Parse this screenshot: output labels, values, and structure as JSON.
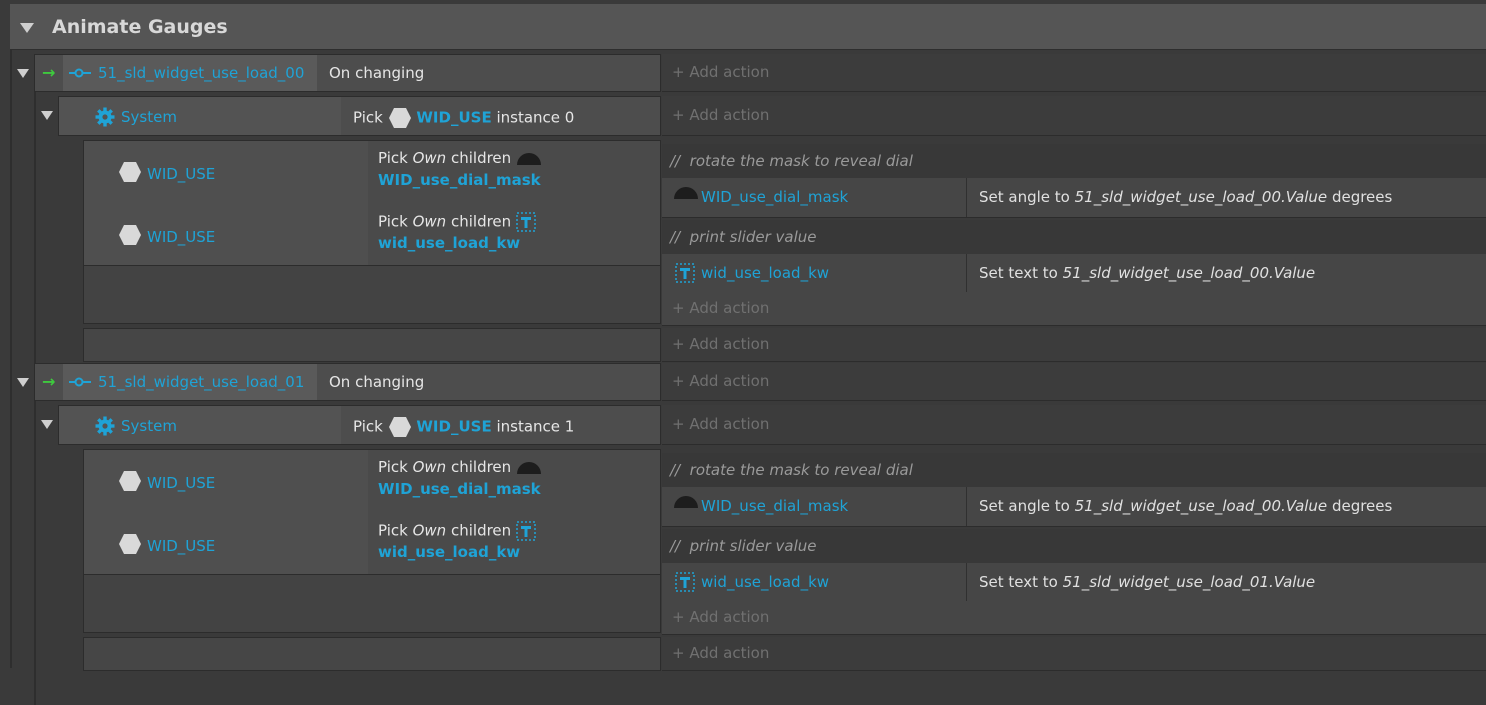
{
  "group": {
    "title": "Animate Gauges"
  },
  "add_action_label": "Add action",
  "blocks": [
    {
      "trigger_object": "51_sld_widget_use_load_00",
      "trigger_condition": "On changing",
      "system_label": "System",
      "pick_word": "Pick",
      "pick_object": "WID_USE",
      "pick_instance": "instance 0",
      "sub1_object": "WID_USE",
      "sub1_pick": "Pick",
      "sub1_own": "Own",
      "sub1_children": "children",
      "sub1_target": "WID_use_dial_mask",
      "sub2_object": "WID_USE",
      "sub2_pick": "Pick",
      "sub2_own": "Own",
      "sub2_children": "children",
      "sub2_target": "wid_use_load_kw",
      "comment1": "rotate the mask to reveal dial",
      "action1_object": "WID_use_dial_mask",
      "action1_prefix": "Set angle to",
      "action1_expr": "51_sld_widget_use_load_00.Value",
      "action1_suffix": "degrees",
      "comment2": "print slider value",
      "action2_object": "wid_use_load_kw",
      "action2_prefix": "Set text to",
      "action2_expr": "51_sld_widget_use_load_00.Value"
    },
    {
      "trigger_object": "51_sld_widget_use_load_01",
      "trigger_condition": "On changing",
      "system_label": "System",
      "pick_word": "Pick",
      "pick_object": "WID_USE",
      "pick_instance": "instance 1",
      "sub1_object": "WID_USE",
      "sub1_pick": "Pick",
      "sub1_own": "Own",
      "sub1_children": "children",
      "sub1_target": "WID_use_dial_mask",
      "sub2_object": "WID_USE",
      "sub2_pick": "Pick",
      "sub2_own": "Own",
      "sub2_children": "children",
      "sub2_target": "wid_use_load_kw",
      "comment1": "rotate the mask to reveal dial",
      "action1_object": "WID_use_dial_mask",
      "action1_prefix": "Set angle to",
      "action1_expr": "51_sld_widget_use_load_00.Value",
      "action1_suffix": "degrees",
      "comment2": "print slider value",
      "action2_object": "wid_use_load_kw",
      "action2_prefix": "Set text to",
      "action2_expr": "51_sld_widget_use_load_01.Value"
    }
  ],
  "colors": {
    "background": "#3a3a3a",
    "header": "#555555",
    "row": "#464646",
    "accent_blue": "#1fa3d6",
    "trigger_green": "#3ec93e"
  }
}
